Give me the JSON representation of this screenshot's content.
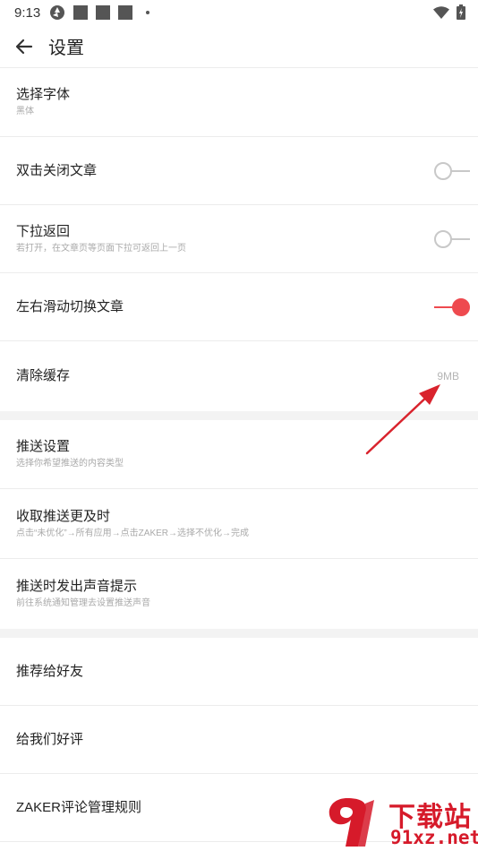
{
  "status_bar": {
    "time": "9:13"
  },
  "header": {
    "title": "设置"
  },
  "settings": {
    "font": {
      "title": "选择字体",
      "subtitle": "黑体"
    },
    "double_tap_close": {
      "title": "双击关闭文章",
      "enabled": false
    },
    "pull_down_return": {
      "title": "下拉返回",
      "subtitle": "若打开，在文章页等页面下拉可返回上一页",
      "enabled": false
    },
    "swipe_switch": {
      "title": "左右滑动切换文章",
      "enabled": true
    },
    "clear_cache": {
      "title": "清除缓存",
      "value": "9MB"
    },
    "push_settings": {
      "title": "推送设置",
      "subtitle": "选择你希望推送的内容类型"
    },
    "timely_push": {
      "title": "收取推送更及时",
      "subtitle": "点击“未优化”→所有应用→点击ZAKER→选择不优化→完成"
    },
    "push_sound": {
      "title": "推送时发出声音提示",
      "subtitle": "前往系统通知管理去设置推送声音"
    },
    "recommend": {
      "title": "推荐给好友"
    },
    "rate_us": {
      "title": "给我们好评"
    },
    "comment_rules": {
      "title": "ZAKER评论管理规则"
    }
  },
  "watermark": {
    "brand_top": "下载站",
    "brand_bottom": "91xz.net"
  },
  "colors": {
    "accent": "#ee4a4f",
    "annotation_arrow": "#d9232d"
  }
}
